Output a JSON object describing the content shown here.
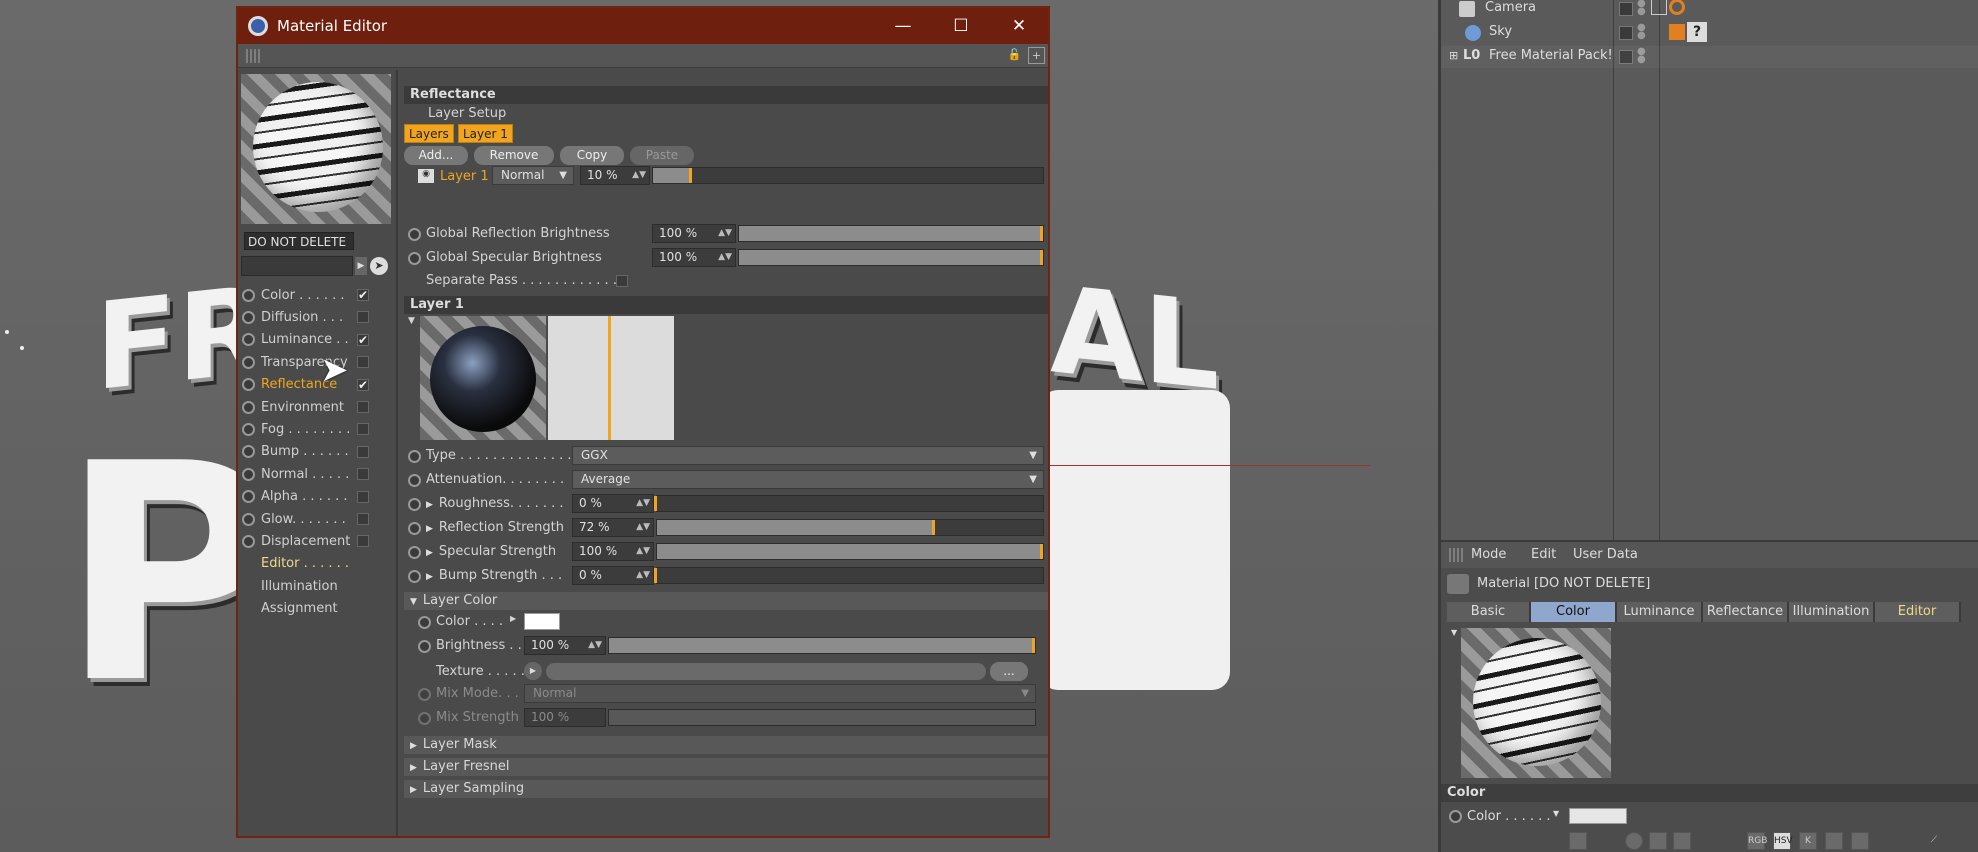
{
  "window": {
    "title": "Material Editor"
  },
  "window_controls": {
    "minimize": "—",
    "maximize": "☐",
    "close": "✕"
  },
  "material_name": "DO NOT DELETE",
  "channels": [
    {
      "label": "Color . . . . . .",
      "checked": true
    },
    {
      "label": "Diffusion . . .",
      "checked": false
    },
    {
      "label": "Luminance . .",
      "checked": true
    },
    {
      "label": "Transparency",
      "checked": false
    },
    {
      "label": "Reflectance",
      "checked": true,
      "active": true
    },
    {
      "label": "Environment",
      "checked": false
    },
    {
      "label": "Fog . . . . . . . .",
      "checked": false
    },
    {
      "label": "Bump . . . . . .",
      "checked": false
    },
    {
      "label": "Normal . . . . .",
      "checked": false
    },
    {
      "label": "Alpha . . . . . .",
      "checked": false
    },
    {
      "label": "Glow. . . . . . .",
      "checked": false
    },
    {
      "label": "Displacement",
      "checked": false
    }
  ],
  "extra_nav": [
    "Editor . . . . . .",
    "Illumination",
    "Assignment"
  ],
  "reflectance": {
    "header": "Reflectance",
    "layer_setup": "Layer Setup",
    "tabs": [
      "Layers",
      "Layer 1"
    ],
    "buttons": {
      "add": "Add...",
      "remove": "Remove",
      "copy": "Copy",
      "paste": "Paste"
    },
    "layer_row": {
      "name": "Layer 1",
      "blend": "Normal",
      "value": "10 %",
      "level": 0.1
    },
    "global_reflection": {
      "label": "Global Reflection Brightness",
      "value": "100 %",
      "level": 1.0
    },
    "global_specular": {
      "label": "Global Specular Brightness",
      "value": "100 %",
      "level": 1.0
    },
    "separate_pass": "Separate Pass . . . . . . . . . . . ."
  },
  "layer1": {
    "header": "Layer 1",
    "type": {
      "label": "Type . . . . . . . . . . . . . .",
      "value": "GGX"
    },
    "attenuation": {
      "label": "Attenuation. . . . . . . .",
      "value": "Average"
    },
    "roughness": {
      "label": "Roughness. . . . . . .",
      "value": "0 %",
      "level": 0.0
    },
    "reflection_strength": {
      "label": "Reflection Strength",
      "value": "72 %",
      "level": 0.72
    },
    "specular_strength": {
      "label": "Specular Strength",
      "value": "100 %",
      "level": 1.0
    },
    "bump_strength": {
      "label": "Bump Strength . . .",
      "value": "0 %",
      "level": 0.0
    }
  },
  "layer_color": {
    "header": "Layer Color",
    "color_label": "Color . . . .",
    "color_value": "#ffffff",
    "brightness": {
      "label": "Brightness . .",
      "value": "100 %",
      "level": 1.0
    },
    "texture": {
      "label": "Texture . . . . .",
      "more": "..."
    },
    "mix_mode": {
      "label": "Mix Mode. . .",
      "value": "Normal"
    },
    "mix_strength": {
      "label": "Mix Strength",
      "value": "100 %"
    }
  },
  "collapsed_sections": [
    "Layer Mask",
    "Layer Fresnel",
    "Layer Sampling"
  ],
  "object_manager": [
    {
      "name": "Camera"
    },
    {
      "name": "Sky"
    },
    {
      "name": "Free Material Pack!"
    }
  ],
  "attributes": {
    "menu": [
      "Mode",
      "Edit",
      "User Data"
    ],
    "title": "Material [DO NOT DELETE]",
    "tabs": [
      "Basic",
      "Color",
      "Luminance",
      "Reflectance",
      "Illumination",
      "Editor"
    ],
    "selected_tab": "Color",
    "section": "Color",
    "color_label": "Color . . . . . ."
  },
  "colors": {
    "accent": "#f1a51f",
    "titlebar": "#6e1f0d",
    "panel": "#4a4a4a",
    "selected_tab": "#8fa7cc"
  }
}
